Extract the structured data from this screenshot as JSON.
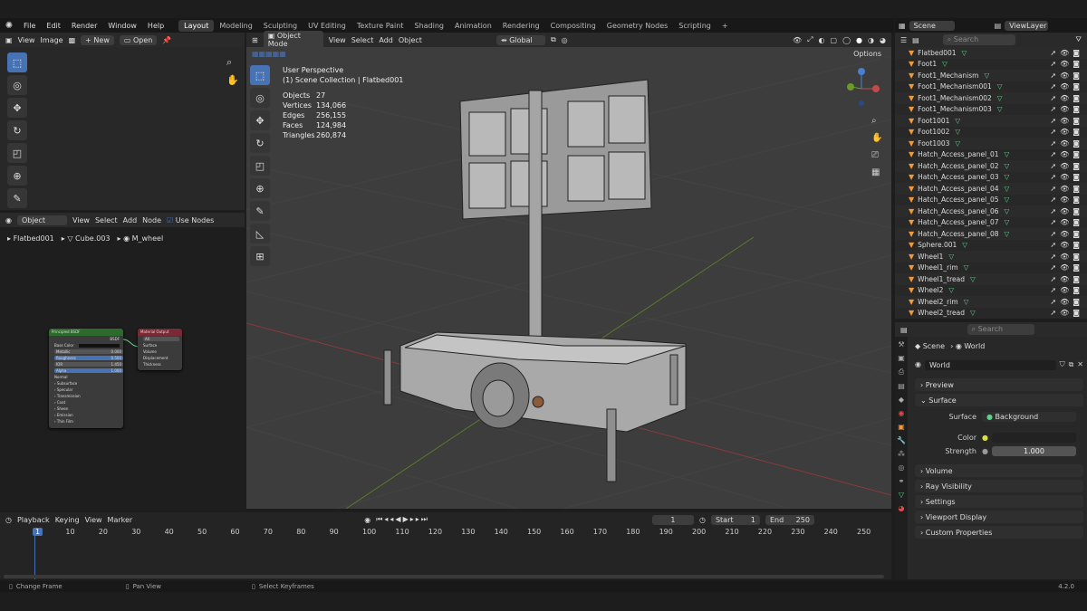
{
  "menu": {
    "items": [
      "File",
      "Edit",
      "Render",
      "Window",
      "Help"
    ]
  },
  "workspaces": [
    {
      "label": "Layout",
      "active": true
    },
    {
      "label": "Modeling"
    },
    {
      "label": "Sculpting"
    },
    {
      "label": "UV Editing"
    },
    {
      "label": "Texture Paint"
    },
    {
      "label": "Shading"
    },
    {
      "label": "Animation"
    },
    {
      "label": "Rendering"
    },
    {
      "label": "Compositing"
    },
    {
      "label": "Geometry Nodes"
    },
    {
      "label": "Scripting"
    }
  ],
  "scene": {
    "name": "Scene",
    "view_layer": "ViewLayer"
  },
  "image_editor": {
    "view": "View",
    "image": "Image",
    "new": "New",
    "open": "Open"
  },
  "node_editor": {
    "mode": "Object",
    "view": "View",
    "select": "Select",
    "add": "Add",
    "node": "Node",
    "use_nodes": "Use Nodes",
    "breadcrumb": [
      "Flatbed001",
      "Cube.003",
      "M_wheel"
    ],
    "bsdf": {
      "title": "Principled BSDF",
      "out": "BSDF",
      "rows": [
        "Base Color",
        "Metallic",
        "Roughness",
        "IOR",
        "Alpha",
        "Normal",
        "Subsurface",
        "Specular",
        "Transmission",
        "Coat",
        "Sheen",
        "Emission",
        "Thin Film"
      ],
      "metallic": "0.000",
      "roughness": "0.500",
      "ior": "1.450",
      "alpha": "1.000"
    },
    "output": {
      "title": "Material Output",
      "target": "All",
      "rows": [
        "Surface",
        "Volume",
        "Displacement",
        "Thickness"
      ]
    }
  },
  "viewport": {
    "mode": "Object Mode",
    "view": "View",
    "select": "Select",
    "add": "Add",
    "object": "Object",
    "orientation": "Global",
    "options": "Options",
    "perspective": "User Perspective",
    "collection": "(1) Scene Collection | Flatbed001",
    "stats": [
      [
        "Objects",
        "27"
      ],
      [
        "Vertices",
        "134,066"
      ],
      [
        "Edges",
        "256,155"
      ],
      [
        "Faces",
        "124,984"
      ],
      [
        "Triangles",
        "260,874"
      ]
    ]
  },
  "outliner": {
    "search_placeholder": "Search",
    "items": [
      "Flatbed001",
      "Foot1",
      "Foot1_Mechanism",
      "Foot1_Mechanism001",
      "Foot1_Mechanism002",
      "Foot1_Mechanism003",
      "Foot1001",
      "Foot1002",
      "Foot1003",
      "Hatch_Access_panel_01",
      "Hatch_Access_panel_02",
      "Hatch_Access_panel_03",
      "Hatch_Access_panel_04",
      "Hatch_Access_panel_05",
      "Hatch_Access_panel_06",
      "Hatch_Access_panel_07",
      "Hatch_Access_panel_08",
      "Sphere.001",
      "Wheel1",
      "Wheel1_rim",
      "Wheel1_tread",
      "Wheel2",
      "Wheel2_rim",
      "Wheel2_tread"
    ]
  },
  "properties": {
    "search_placeholder": "Search",
    "breadcrumb": [
      "Scene",
      "World"
    ],
    "world": "World",
    "sections": [
      "Preview",
      "Surface",
      "Volume",
      "Ray Visibility",
      "Settings",
      "Viewport Display",
      "Custom Properties"
    ],
    "surface_label": "Surface",
    "surface_value": "Background",
    "color_label": "Color",
    "strength_label": "Strength",
    "strength_value": "1.000"
  },
  "timeline": {
    "playback": "Playback",
    "keying": "Keying",
    "view": "View",
    "marker": "Marker",
    "current_frame": "1",
    "start_label": "Start",
    "start": "1",
    "end_label": "End",
    "end": "250",
    "ticks": [
      "1",
      "10",
      "20",
      "30",
      "40",
      "50",
      "60",
      "70",
      "80",
      "90",
      "100",
      "110",
      "120",
      "130",
      "140",
      "150",
      "160",
      "170",
      "180",
      "190",
      "200",
      "210",
      "220",
      "230",
      "240",
      "250"
    ]
  },
  "status": {
    "change_frame": "Change Frame",
    "pan_view": "Pan View",
    "select_keyframes": "Select Keyframes",
    "version": "4.2.0"
  }
}
